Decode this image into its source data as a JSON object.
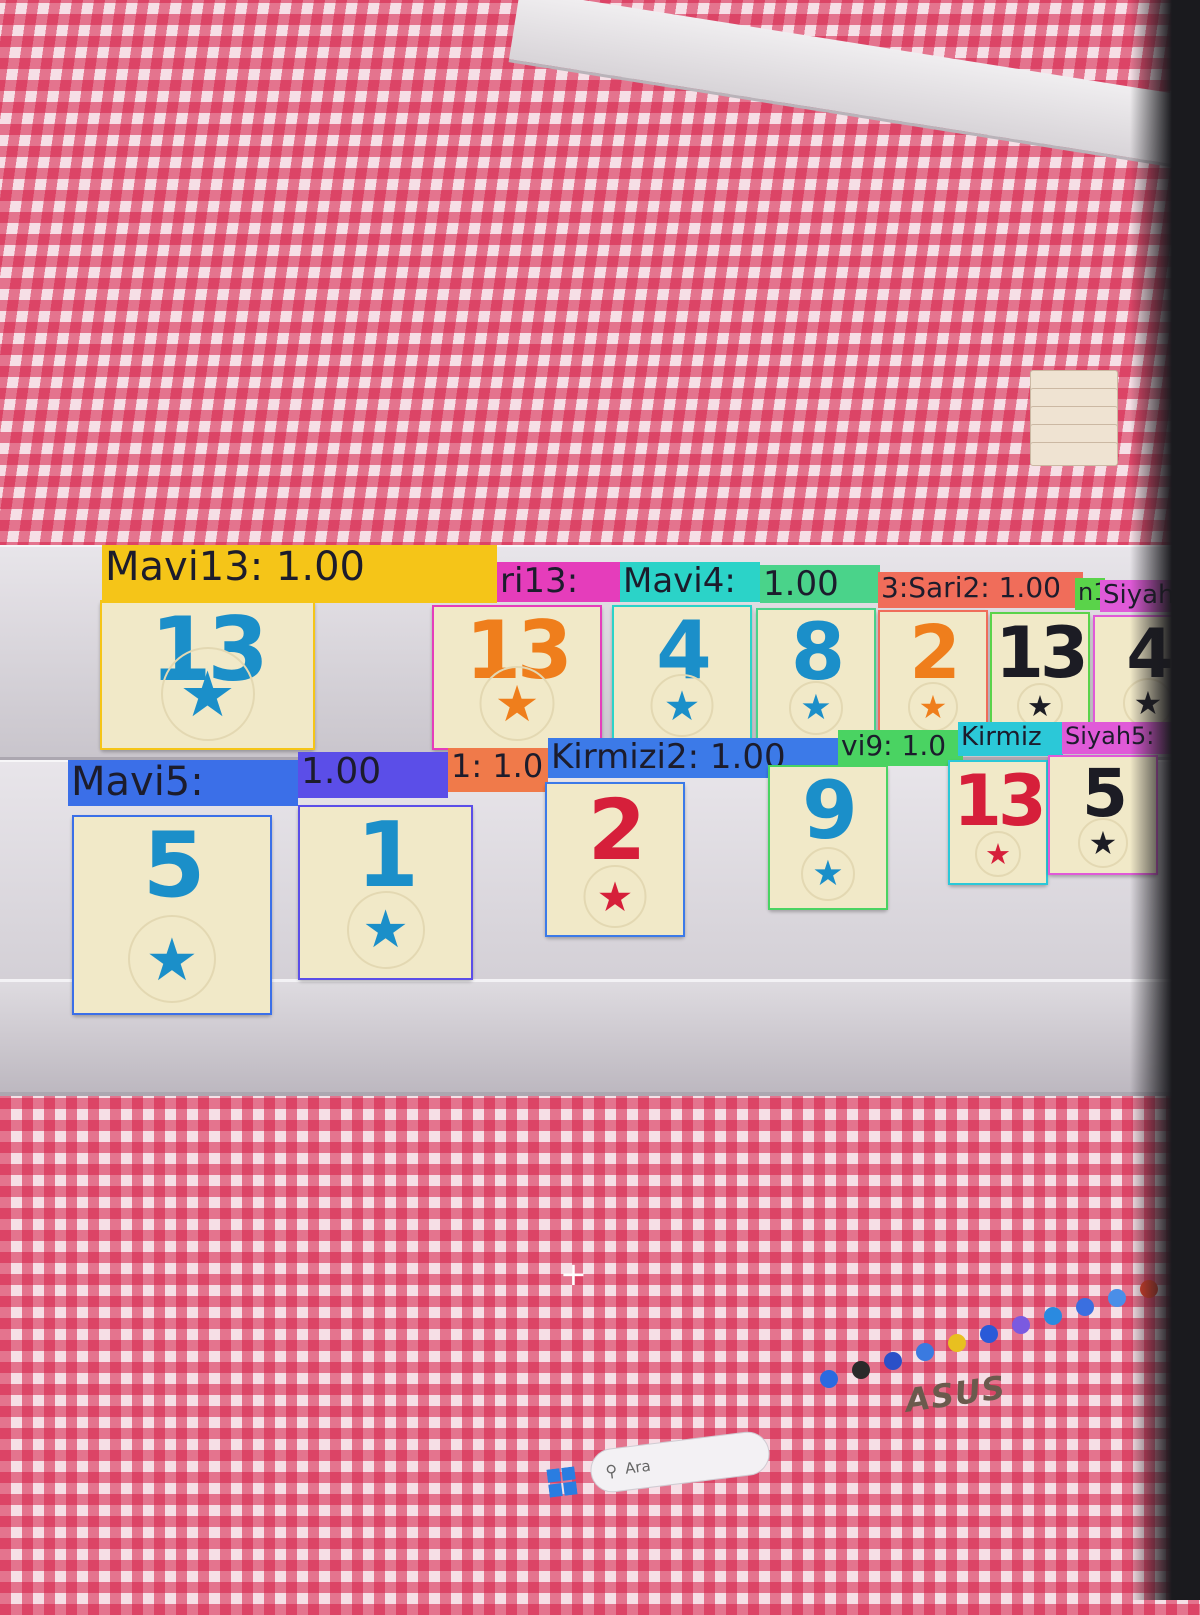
{
  "detections": [
    {
      "label": "Mavi13: 1.00",
      "color": "#f5c518",
      "tile_number": "13",
      "tile_color": "#1b8fc9"
    },
    {
      "label": "ri13:",
      "color": "#e53dbb",
      "tile_number": "13",
      "tile_color": "#ef7e1c"
    },
    {
      "label": "Mavi4:",
      "color": "#2bd3c8",
      "tile_number": "4",
      "tile_color": "#1b8fc9"
    },
    {
      "label": "1.00",
      "color": "#4ad38a",
      "tile_number": "8",
      "tile_color": "#1b8fc9"
    },
    {
      "label": "3:Sari2: 1.00",
      "color": "#f06d5a",
      "tile_number": "2",
      "tile_color": "#ef7e1c"
    },
    {
      "label": "n1",
      "color": "#5ad34a",
      "tile_number": "13",
      "tile_color": "#1c1c24"
    },
    {
      "label": "Siyah",
      "color": "#e05ad8",
      "tile_number": "4",
      "tile_color": "#1c1c24"
    },
    {
      "label": "Mavi5:",
      "color": "#3b6fe8",
      "tile_number": "5",
      "tile_color": "#1b8fc9"
    },
    {
      "label": "1.00",
      "color": "#5b4ee8",
      "tile_number": "1",
      "tile_color": "#1b8fc9"
    },
    {
      "label": "1:  1.0",
      "color": "#f07a4a",
      "tile_number": "",
      "tile_color": ""
    },
    {
      "label": "Kirmizi2: 1.00",
      "color": "#3c7ae8",
      "tile_number": "2",
      "tile_color": "#d61f3a"
    },
    {
      "label": "vi9: 1.0",
      "color": "#4ad362",
      "tile_number": "9",
      "tile_color": "#1b8fc9"
    },
    {
      "label": "Kirmiz",
      "color": "#2bc8d8",
      "tile_number": "13",
      "tile_color": "#d61f3a"
    },
    {
      "label": "Siyah5:",
      "color": "#e05ad8",
      "tile_number": "5",
      "tile_color": "#1c1c24"
    }
  ],
  "taskbar": {
    "search_placeholder": "Ara"
  },
  "monitor_brand": "ASUS",
  "star_glyph": "★",
  "cursor_glyph": "+"
}
